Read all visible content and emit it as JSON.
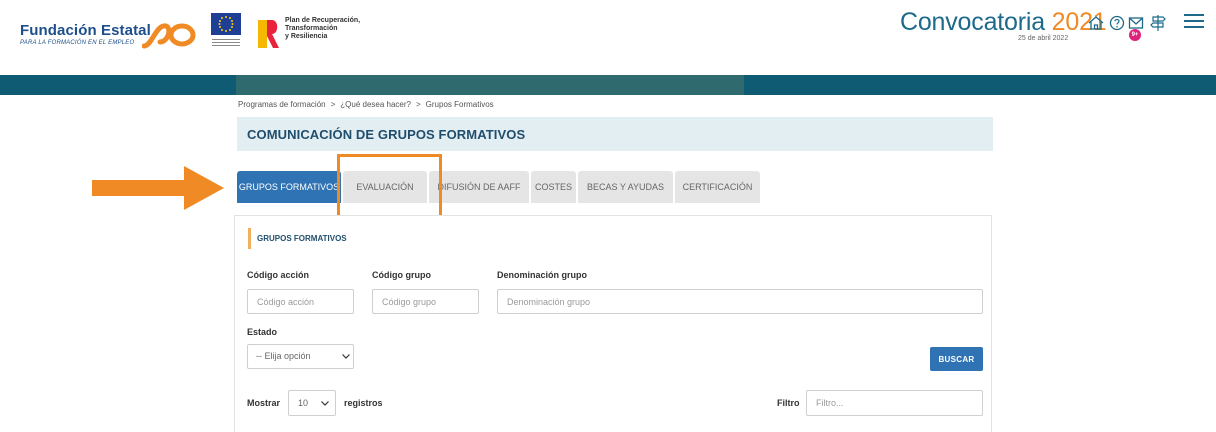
{
  "header": {
    "brand_name": "Fundación Estatal",
    "brand_sub": "PARA LA FORMACIÓN EN EL EMPLEO",
    "prtr_line1": "Plan de Recuperación,",
    "prtr_line2": "Transformación",
    "prtr_line3": "y Resiliencia",
    "convocatoria_label": "Convocatoria",
    "convocatoria_year": "2021",
    "date": "25 de abril 2022",
    "notification_badge": "9+",
    "icons": [
      "home-icon",
      "help-icon",
      "mail-icon",
      "signpost-icon",
      "menu-icon"
    ],
    "colors": {
      "primary": "#1d4f8a",
      "accent": "#f08a24",
      "teal": "#0f5b73",
      "active_tab": "#2f73b4",
      "badge": "#e0207a"
    }
  },
  "breadcrumb": {
    "items": [
      "Programas de formación",
      "¿Qué desea hacer?",
      "Grupos Formativos"
    ],
    "separator": ">"
  },
  "page_title": "COMUNICACIÓN DE GRUPOS FORMATIVOS",
  "tabs": [
    {
      "label": "GRUPOS FORMATIVOS",
      "active": true
    },
    {
      "label": "EVALUACIÓN",
      "active": false
    },
    {
      "label": "DIFUSIÓN DE AAFF",
      "active": false
    },
    {
      "label": "COSTES",
      "active": false
    },
    {
      "label": "BECAS Y AYUDAS",
      "active": false
    },
    {
      "label": "CERTIFICACIÓN",
      "active": false
    }
  ],
  "annotation": {
    "arrow_color": "#f08a24",
    "highlighted_tab": "EVALUACIÓN"
  },
  "form": {
    "section_title": "GRUPOS FORMATIVOS",
    "codigo_accion": {
      "label": "Código acción",
      "placeholder": "Código acción",
      "value": ""
    },
    "codigo_grupo": {
      "label": "Código grupo",
      "placeholder": "Código grupo",
      "value": ""
    },
    "denominacion": {
      "label": "Denominación grupo",
      "placeholder": "Denominación grupo",
      "value": ""
    },
    "estado": {
      "label": "Estado",
      "selected": "-- Elija opción"
    },
    "search_button": "BUSCAR"
  },
  "table_controls": {
    "show_label": "Mostrar",
    "page_length": "10",
    "records_label": "registros",
    "filter_label": "Filtro",
    "filter_placeholder": "Filtro..."
  }
}
